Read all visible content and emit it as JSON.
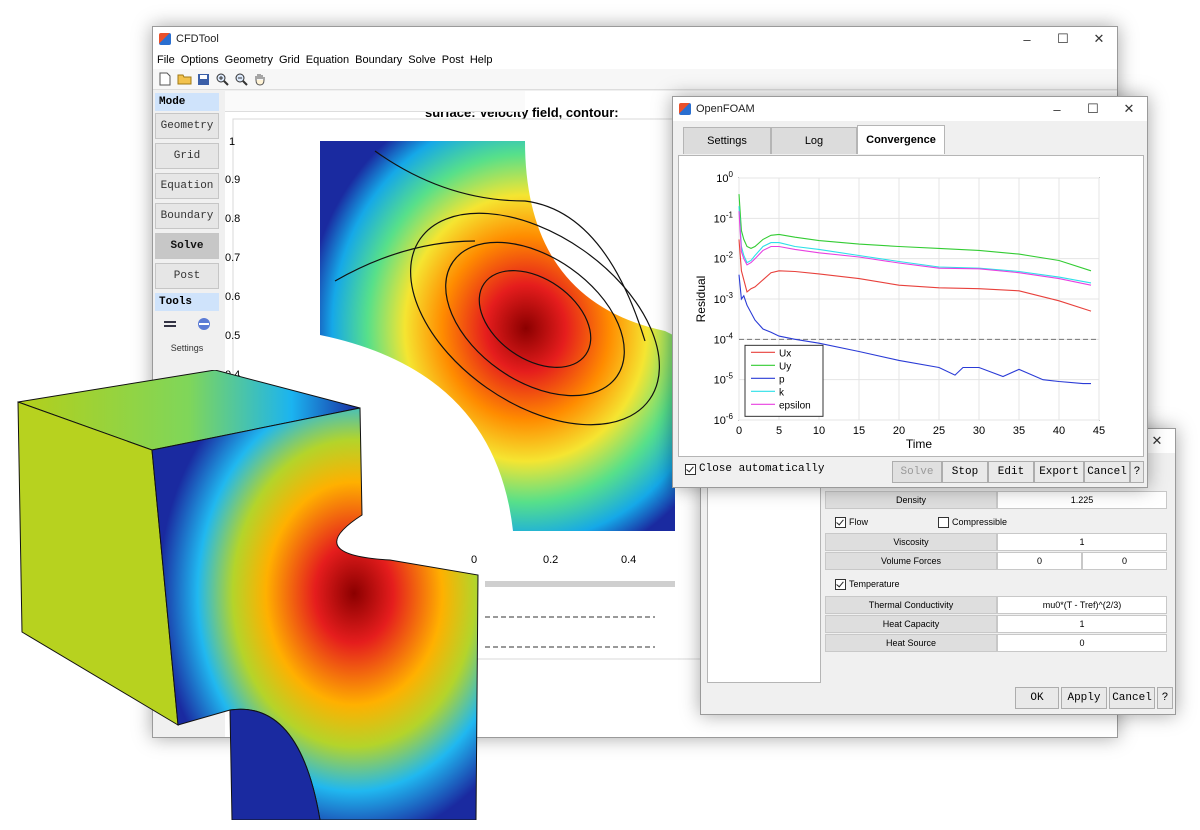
{
  "main_window": {
    "title": "CFDTool",
    "menus": [
      "File",
      "Options",
      "Geometry",
      "Grid",
      "Equation",
      "Boundary",
      "Solve",
      "Post",
      "Help"
    ],
    "toolbar_icons": [
      "new-file-icon",
      "open-folder-icon",
      "save-icon",
      "zoom-in-icon",
      "zoom-out-icon",
      "pan-hand-icon"
    ],
    "sidebar": {
      "mode_header": "Mode",
      "modes": [
        "Geometry",
        "Grid",
        "Equation",
        "Boundary",
        "Solve",
        "Post"
      ],
      "active_mode": "Solve",
      "tools_header": "Tools",
      "settings_label": "Settings"
    },
    "plot": {
      "title": "surface: Velocity field, contour:",
      "y_ticks": [
        "1",
        "0.9",
        "0.8",
        "0.7",
        "0.6",
        "0.5",
        "0.4"
      ],
      "x_ticks": [
        "0",
        "0.2",
        "0.4"
      ]
    }
  },
  "openfoam_window": {
    "title": "OpenFOAM",
    "tabs": [
      "Settings",
      "Log",
      "Convergence"
    ],
    "active_tab": "Convergence",
    "close_automatically_label": "Close automatically",
    "close_automatically_checked": true,
    "buttons": {
      "solve": "Solve",
      "stop": "Stop",
      "edit": "Edit",
      "export": "Export",
      "cancel": "Cancel",
      "help": "?"
    }
  },
  "chart_data": {
    "type": "line",
    "xlabel": "Time",
    "ylabel": "Residual",
    "xlim": [
      0,
      45
    ],
    "ylim_log10": [
      -6,
      0
    ],
    "y_scale": "log",
    "x_ticks": [
      "0",
      "5",
      "10",
      "15",
      "20",
      "25",
      "30",
      "35",
      "40",
      "45"
    ],
    "y_tick_exponents": [
      "0",
      "-1",
      "-2",
      "-3",
      "-4",
      "-5",
      "-6"
    ],
    "grid": true,
    "legend_position": "bottom-left",
    "reference_line_y": 0.0001,
    "series": [
      {
        "name": "Ux",
        "color": "#e8413c",
        "x": [
          0,
          0.3,
          0.6,
          1,
          1.5,
          2,
          3,
          4,
          5,
          7,
          10,
          15,
          20,
          25,
          30,
          35,
          40,
          44
        ],
        "y": [
          0.03,
          0.005,
          0.003,
          0.0015,
          0.0018,
          0.002,
          0.003,
          0.0045,
          0.005,
          0.0048,
          0.0042,
          0.0032,
          0.0022,
          0.0019,
          0.0018,
          0.0016,
          0.0009,
          0.0005
        ]
      },
      {
        "name": "Uy",
        "color": "#33cc33",
        "x": [
          0,
          0.3,
          0.6,
          1,
          1.5,
          2,
          3,
          4,
          5,
          7,
          10,
          15,
          20,
          25,
          30,
          35,
          40,
          44
        ],
        "y": [
          0.4,
          0.05,
          0.03,
          0.02,
          0.018,
          0.02,
          0.03,
          0.038,
          0.04,
          0.034,
          0.028,
          0.023,
          0.02,
          0.018,
          0.016,
          0.013,
          0.009,
          0.005
        ]
      },
      {
        "name": "p",
        "color": "#2a3bd6",
        "x": [
          0,
          0.3,
          0.6,
          1,
          2,
          3,
          4,
          5,
          7,
          10,
          15,
          20,
          25,
          27,
          28,
          30,
          33,
          35,
          38,
          40,
          43,
          44
        ],
        "y": [
          0.004,
          0.001,
          0.0012,
          0.0007,
          0.0003,
          0.00018,
          0.00015,
          0.00012,
          0.0001,
          8e-05,
          5e-05,
          3e-05,
          2e-05,
          1.3e-05,
          2e-05,
          2e-05,
          1.2e-05,
          1.8e-05,
          1e-05,
          9e-06,
          8e-06,
          8e-06
        ]
      },
      {
        "name": "k",
        "color": "#2de0e8",
        "x": [
          0,
          0.3,
          0.6,
          1,
          1.5,
          2,
          3,
          4,
          5,
          7,
          10,
          15,
          20,
          25,
          30,
          35,
          40,
          44
        ],
        "y": [
          0.2,
          0.02,
          0.012,
          0.008,
          0.009,
          0.012,
          0.02,
          0.025,
          0.025,
          0.02,
          0.017,
          0.012,
          0.0085,
          0.0062,
          0.0058,
          0.0048,
          0.0035,
          0.0025
        ]
      },
      {
        "name": "epsilon",
        "color": "#e840e0",
        "x": [
          0,
          0.3,
          0.6,
          1,
          1.5,
          2,
          3,
          4,
          5,
          7,
          10,
          15,
          20,
          25,
          30,
          35,
          40,
          44
        ],
        "y": [
          0.15,
          0.015,
          0.01,
          0.007,
          0.008,
          0.01,
          0.016,
          0.02,
          0.02,
          0.017,
          0.014,
          0.011,
          0.0078,
          0.0058,
          0.0056,
          0.0045,
          0.0032,
          0.0022
        ]
      }
    ]
  },
  "physics_window": {
    "rows": [
      {
        "label": "Density",
        "values": [
          "1.225"
        ]
      },
      {
        "check": "Flow",
        "checked": true,
        "check2": "Compressible",
        "checked2": false
      },
      {
        "label": "Viscosity",
        "values": [
          "1"
        ]
      },
      {
        "label": "Volume Forces",
        "values": [
          "0",
          "0"
        ]
      },
      {
        "check": "Temperature",
        "checked": true
      },
      {
        "label": "Thermal Conductivity",
        "values": [
          "mu0*(T - Tref)^(2/3)"
        ]
      },
      {
        "label": "Heat Capacity",
        "values": [
          "1"
        ]
      },
      {
        "label": "Heat Source",
        "values": [
          "0"
        ]
      }
    ],
    "buttons": {
      "ok": "OK",
      "apply": "Apply",
      "cancel": "Cancel",
      "help": "?"
    }
  }
}
